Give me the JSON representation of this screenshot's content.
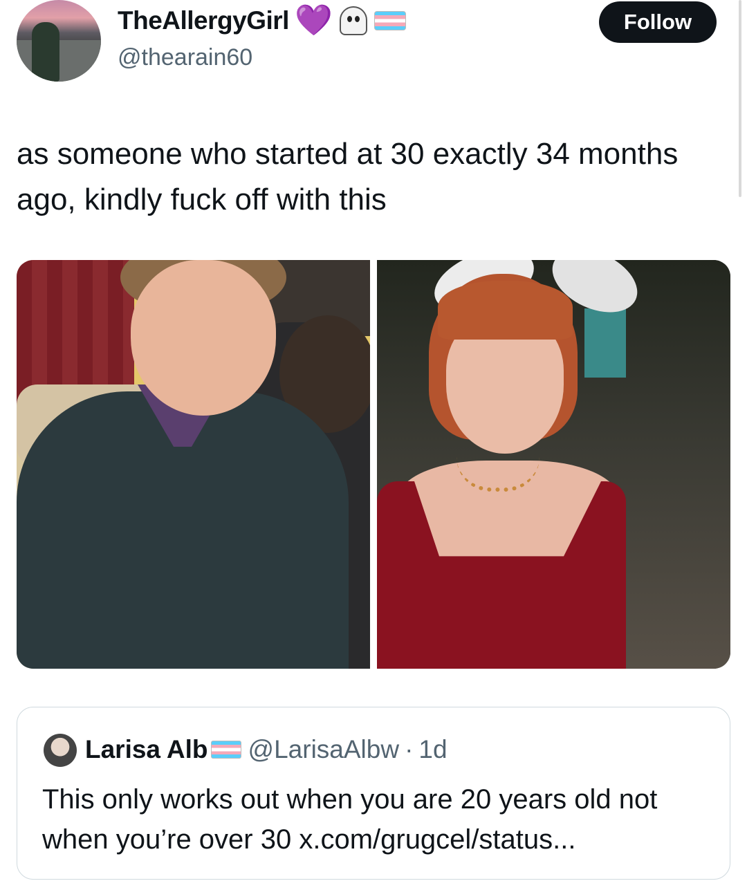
{
  "author": {
    "display_name": "TheAllergyGirl",
    "handle": "@thearain60",
    "badges": [
      "purple-heart-icon",
      "ghost-icon",
      "trans-flag-icon"
    ],
    "heart_glyph": "💜"
  },
  "follow_button": {
    "label": "Follow"
  },
  "tweet": {
    "text": "as someone who started at 30 exactly 34 months ago, kindly fuck off with this"
  },
  "media": {
    "items": [
      {
        "name": "photo-before"
      },
      {
        "name": "photo-after"
      }
    ]
  },
  "quoted_tweet": {
    "display_name": "Larisa Alb",
    "handle": "@LarisaAlbw",
    "separator": "·",
    "time": "1d",
    "text": "This only works out when you are 20 years old not when you’re over 30 x.com/grugcel/status..."
  },
  "colors": {
    "follow_bg": "#0f1419",
    "handle_gray": "#536471",
    "border": "#cfd9de",
    "heart_purple": "#9b3fe0"
  }
}
